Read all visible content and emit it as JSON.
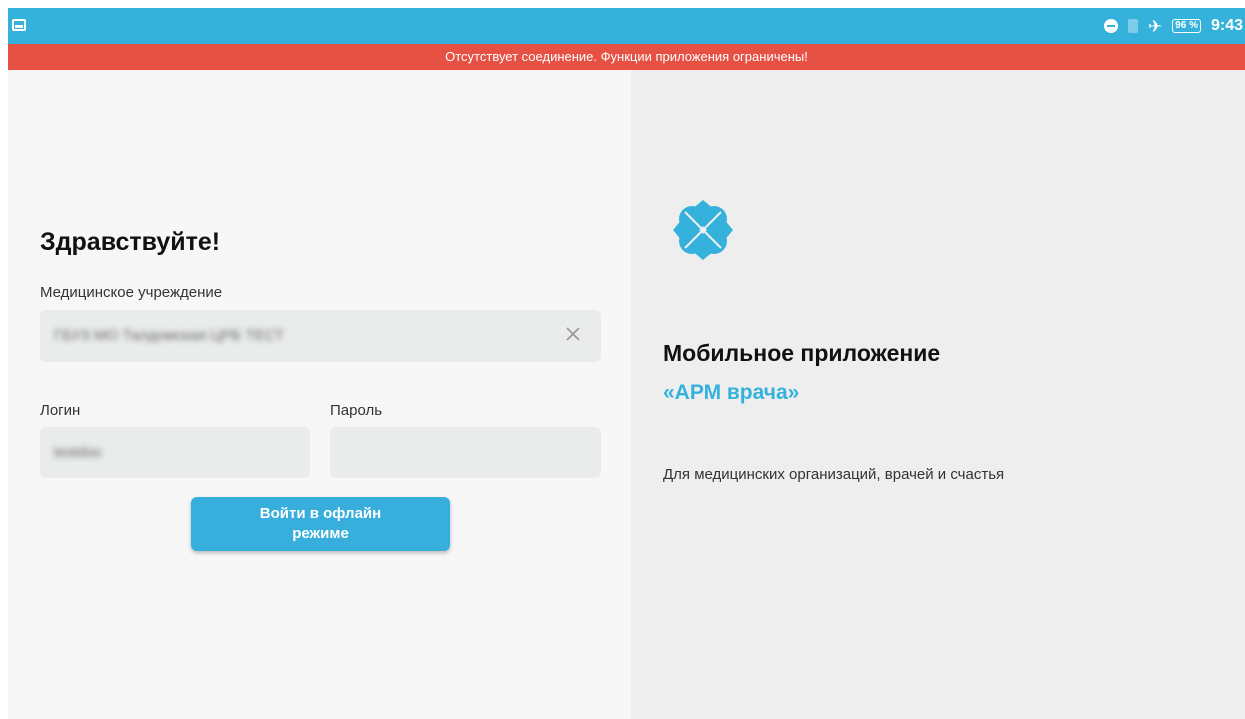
{
  "status_bar": {
    "battery": "96 %",
    "time": "9:43",
    "icons": [
      "image-icon",
      "do-not-disturb-icon",
      "sim-icon",
      "airplane-icon",
      "battery-icon"
    ],
    "background_color": "#35b2dc"
  },
  "banner": {
    "text": "Отсутствует соединение. Функции приложения ограничены!",
    "color": "#e65143"
  },
  "login_form": {
    "greeting": "Здравствуйте!",
    "institution_label": "Медицинское учреждение",
    "institution_value": "ГБУЗ МО Талдомская ЦРБ ТЕСТ",
    "login_label": "Логин",
    "login_value": "testdoc",
    "password_label": "Пароль",
    "password_value": "",
    "offline_button": "Войти в офлайн режиме"
  },
  "info_panel": {
    "title": "Мобильное приложение",
    "app_name": "«АРМ врача»",
    "tagline": "Для медицинских организаций, врачей и счастья",
    "accent_color": "#35b2dc",
    "logo_icon": "clover-logo-icon"
  }
}
